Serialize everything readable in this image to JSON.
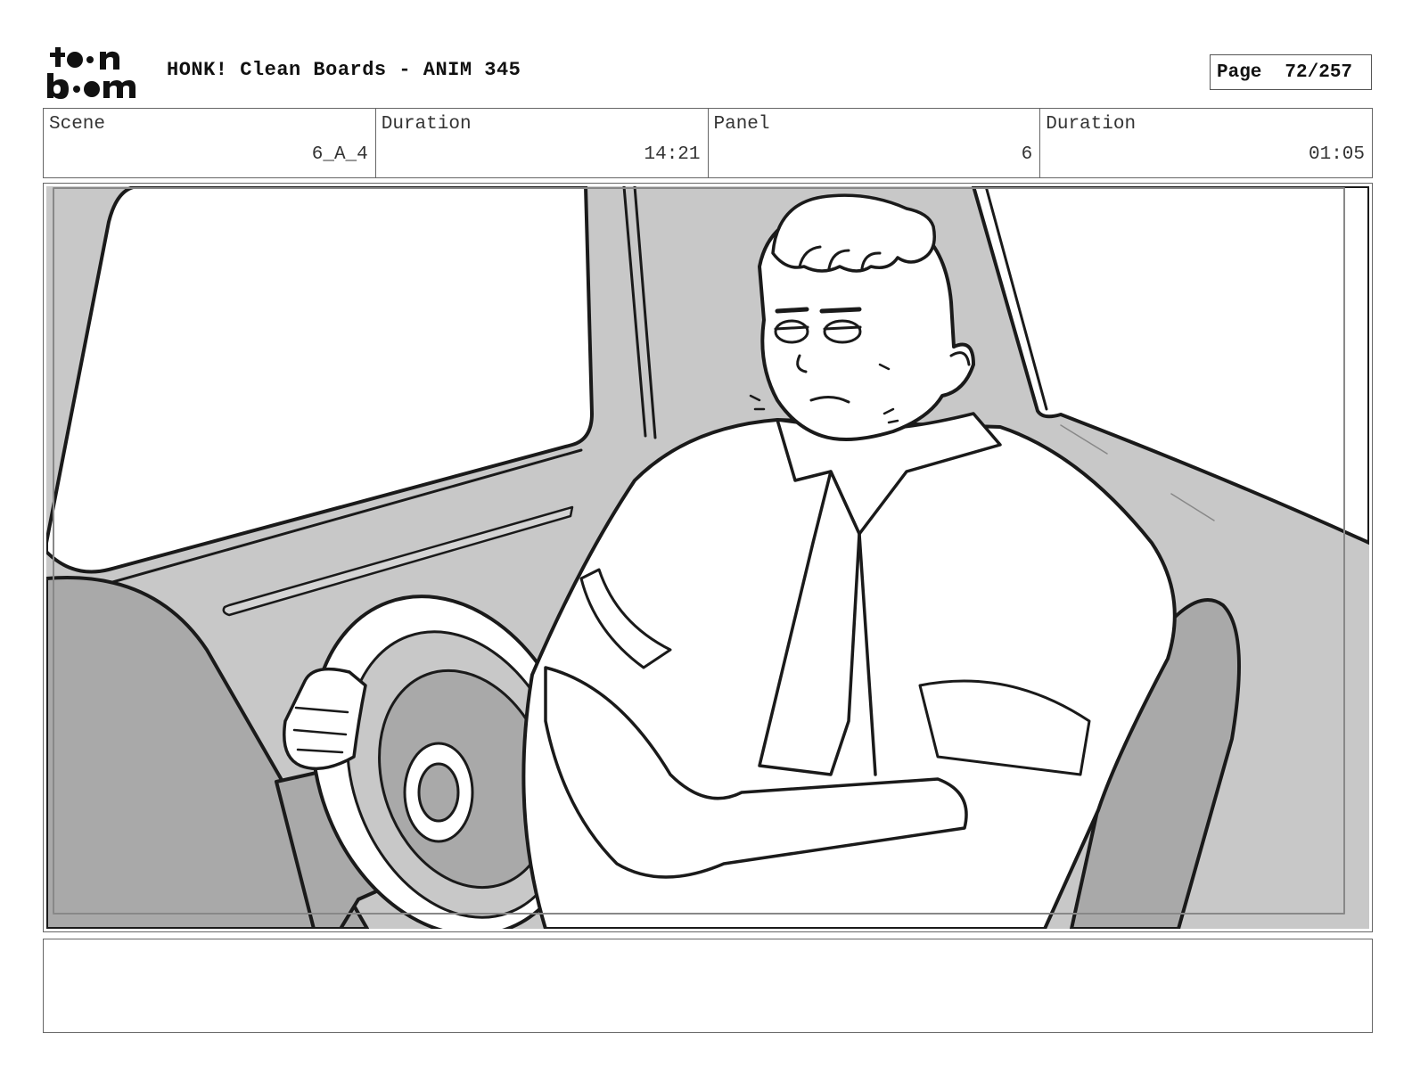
{
  "header": {
    "logo_text": "toon boom",
    "title": "HONK! Clean Boards - ANIM 345",
    "page_label": "Page",
    "page_value": "72/257"
  },
  "info": {
    "scene_label": "Scene",
    "scene_value": "6_A_4",
    "scene_duration_label": "Duration",
    "scene_duration_value": "14:21",
    "panel_label": "Panel",
    "panel_value": "6",
    "panel_duration_label": "Duration",
    "panel_duration_value": "01:05"
  },
  "panel": {
    "colors": {
      "line": "#1a1a1a",
      "interior": "#c8c8c8",
      "shadow": "#a9a9a9",
      "paper": "#ffffff"
    }
  },
  "notes": {
    "text": ""
  }
}
